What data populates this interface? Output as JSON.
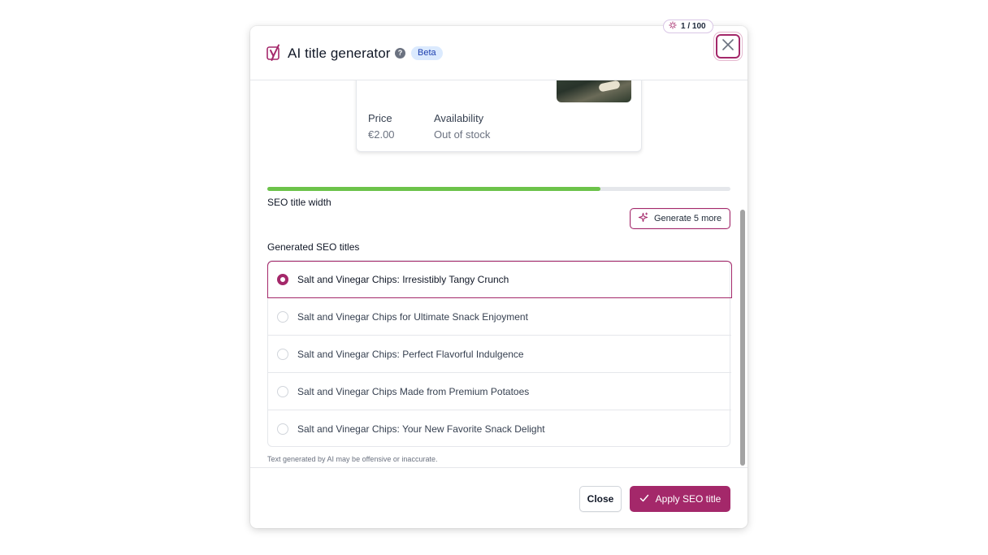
{
  "usage": {
    "count": "1 / 100",
    "icon": "sparkle-icon"
  },
  "header": {
    "title": "AI title generator",
    "help_icon": "?",
    "badge": "Beta"
  },
  "preview": {
    "price_label": "Price",
    "price_value": "€2.00",
    "availability_label": "Availability",
    "availability_value": "Out of stock"
  },
  "seo_width": {
    "label": "SEO title width",
    "progress_percent": 72
  },
  "generated": {
    "label": "Generated SEO titles",
    "generate_more_label": "Generate 5 more",
    "selected_index": 0,
    "options": [
      "Salt and Vinegar Chips: Irresistibly Tangy Crunch",
      "Salt and Vinegar Chips for Ultimate Snack Enjoyment",
      "Salt and Vinegar Chips: Perfect Flavorful Indulgence",
      "Salt and Vinegar Chips Made from Premium Potatoes",
      "Salt and Vinegar Chips: Your New Favorite Snack Delight"
    ]
  },
  "disclaimer": "Text generated by AI may be offensive or inaccurate.",
  "footer": {
    "close_label": "Close",
    "apply_label": "Apply SEO title"
  },
  "colors": {
    "accent": "#a4286a",
    "progress": "#6cc34a",
    "beta_bg": "#dbeafe"
  }
}
